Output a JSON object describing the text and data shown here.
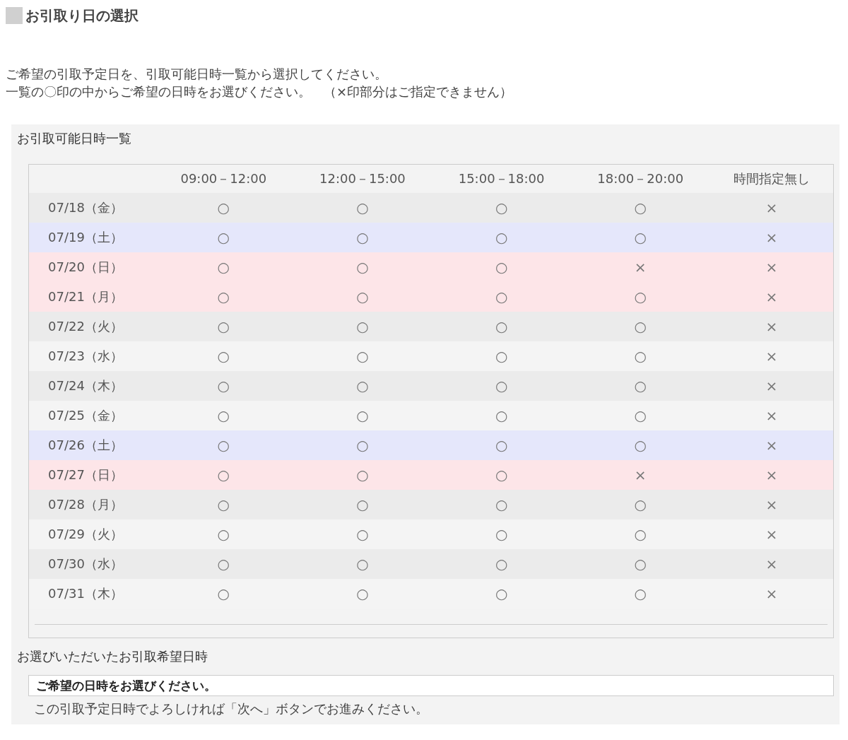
{
  "page_title": "お引取り日の選択",
  "intro": [
    "ご希望の引取予定日を、引取可能日時一覧から選択してください。",
    "一覧の〇印の中からご希望の日時をお選びください。　（×印部分はご指定できません）"
  ],
  "availability": {
    "heading": "お引取可能日時一覧",
    "columns": [
      "09:00－12:00",
      "12:00－15:00",
      "15:00－18:00",
      "18:00－20:00",
      "時間指定無し"
    ],
    "rows": [
      {
        "date": "07/18（金）",
        "kind": "weekday",
        "slots": [
          "○",
          "○",
          "○",
          "○",
          "×"
        ]
      },
      {
        "date": "07/19（土）",
        "kind": "saturday",
        "slots": [
          "○",
          "○",
          "○",
          "○",
          "×"
        ]
      },
      {
        "date": "07/20（日）",
        "kind": "holiday",
        "slots": [
          "○",
          "○",
          "○",
          "×",
          "×"
        ]
      },
      {
        "date": "07/21（月）",
        "kind": "holiday",
        "slots": [
          "○",
          "○",
          "○",
          "○",
          "×"
        ]
      },
      {
        "date": "07/22（火）",
        "kind": "weekday",
        "slots": [
          "○",
          "○",
          "○",
          "○",
          "×"
        ]
      },
      {
        "date": "07/23（水）",
        "kind": "weekday",
        "slots": [
          "○",
          "○",
          "○",
          "○",
          "×"
        ]
      },
      {
        "date": "07/24（木）",
        "kind": "weekday",
        "slots": [
          "○",
          "○",
          "○",
          "○",
          "×"
        ]
      },
      {
        "date": "07/25（金）",
        "kind": "weekday",
        "slots": [
          "○",
          "○",
          "○",
          "○",
          "×"
        ]
      },
      {
        "date": "07/26（土）",
        "kind": "saturday",
        "slots": [
          "○",
          "○",
          "○",
          "○",
          "×"
        ]
      },
      {
        "date": "07/27（日）",
        "kind": "holiday",
        "slots": [
          "○",
          "○",
          "○",
          "×",
          "×"
        ]
      },
      {
        "date": "07/28（月）",
        "kind": "weekday",
        "slots": [
          "○",
          "○",
          "○",
          "○",
          "×"
        ]
      },
      {
        "date": "07/29（火）",
        "kind": "weekday",
        "slots": [
          "○",
          "○",
          "○",
          "○",
          "×"
        ]
      },
      {
        "date": "07/30（水）",
        "kind": "weekday",
        "slots": [
          "○",
          "○",
          "○",
          "○",
          "×"
        ]
      },
      {
        "date": "07/31（木）",
        "kind": "weekday",
        "slots": [
          "○",
          "○",
          "○",
          "○",
          "×"
        ]
      }
    ]
  },
  "selection": {
    "heading": "お選びいただいたお引取希望日時",
    "value": "ご希望の日時をお選びください。",
    "note": "この引取予定日時でよろしければ「次へ」ボタンでお進みください。"
  }
}
